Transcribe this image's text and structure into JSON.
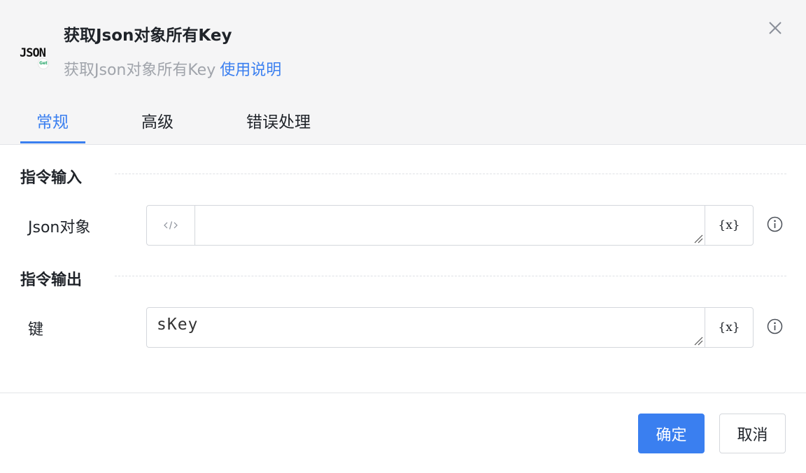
{
  "header": {
    "logo_text": "JSON",
    "logo_badge": "Get",
    "title": "获取Json对象所有Key",
    "subtitle": "获取Json对象所有Key",
    "help_link": "使用说明"
  },
  "tabs": [
    {
      "label": "常规",
      "active": true
    },
    {
      "label": "高级",
      "active": false
    },
    {
      "label": "错误处理",
      "active": false
    }
  ],
  "sections": {
    "input": {
      "title": "指令输入",
      "fields": [
        {
          "label": "Json对象",
          "value": "",
          "var_label": "{x}"
        }
      ]
    },
    "output": {
      "title": "指令输出",
      "fields": [
        {
          "label": "键",
          "value": "sKey",
          "var_label": "{x}"
        }
      ]
    }
  },
  "footer": {
    "confirm_label": "确定",
    "cancel_label": "取消"
  },
  "colors": {
    "accent": "#3a7ff0",
    "header_bg": "#f5f5f6",
    "badge_green": "#21a366"
  },
  "icons": [
    "close-icon",
    "code-icon",
    "variable-icon",
    "info-icon",
    "resize-grip-icon"
  ]
}
